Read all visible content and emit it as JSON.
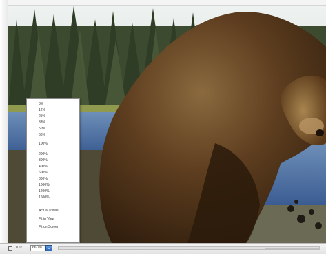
{
  "statusbar": {
    "page_label": "1/ 1/",
    "zoom_value": "66.7%",
    "scroll_arrow": "▸"
  },
  "zoom_menu": {
    "items": [
      "8%",
      "12%",
      "25%",
      "33%",
      "50%",
      "66%",
      "100%",
      "200%",
      "300%",
      "400%",
      "600%",
      "800%",
      "1000%",
      "1200%",
      "1600%",
      "Actual Pixels",
      "Fit in View",
      "Fit on Screen"
    ]
  },
  "colors": {
    "sky": "#e5ebe9",
    "forest": "#38452c",
    "water": "#4f6fa2",
    "bear_fur": "#5a3a1e",
    "accent_dropdown": "#2d66b8"
  }
}
